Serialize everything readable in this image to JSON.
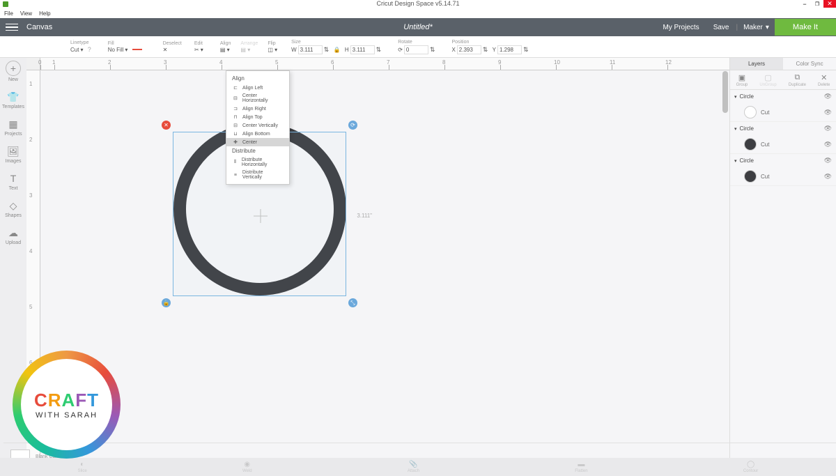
{
  "window": {
    "title": "Cricut Design Space  v5.14.71"
  },
  "menubar": {
    "file": "File",
    "view": "View",
    "help": "Help"
  },
  "topbar": {
    "canvas": "Canvas",
    "doctitle": "Untitled*",
    "myprojects": "My Projects",
    "save": "Save",
    "machine": "Maker",
    "makeit": "Make It"
  },
  "props": {
    "linetype_lbl": "Linetype",
    "linetype_val": "Cut",
    "fill_lbl": "Fill",
    "fill_val": "No Fill",
    "deselect_lbl": "Deselect",
    "edit_lbl": "Edit",
    "align_lbl": "Align",
    "arrange_lbl": "Arrange",
    "flip_lbl": "Flip",
    "size_lbl": "Size",
    "size_w": "3.111",
    "size_h": "3.111",
    "rotate_lbl": "Rotate",
    "rotate_val": "0",
    "position_lbl": "Position",
    "pos_x": "2.393",
    "pos_y": "1.298"
  },
  "leftnav": {
    "new": "New",
    "templates": "Templates",
    "projects": "Projects",
    "images": "Images",
    "text": "Text",
    "shapes": "Shapes",
    "upload": "Upload"
  },
  "alignmenu": {
    "align_hdr": "Align",
    "align_left": "Align Left",
    "center_h": "Center Horizontally",
    "align_right": "Align Right",
    "align_top": "Align Top",
    "center_v": "Center Vertically",
    "align_bottom": "Align Bottom",
    "center": "Center",
    "distribute_hdr": "Distribute",
    "dist_h": "Distribute Horizontally",
    "dist_v": "Distribute Vertically"
  },
  "selection": {
    "dim": "3.111\""
  },
  "rightpanel": {
    "layers_tab": "Layers",
    "colorsync_tab": "Color Sync",
    "group": "Group",
    "ungroup": "UnGroup",
    "duplicate": "Duplicate",
    "delete": "Delete",
    "layers": [
      {
        "name": "Circle",
        "op": "Cut",
        "color": "#ffffff"
      },
      {
        "name": "Circle",
        "op": "Cut",
        "color": "#3d3e42"
      },
      {
        "name": "Circle",
        "op": "Cut",
        "color": "#3d3e42"
      }
    ],
    "blankcanvas": "Blank Canvas",
    "slice": "Slice",
    "weld": "Weld",
    "attach": "Attach",
    "flatten": "Flatten",
    "contour": "Contour"
  },
  "ruler": {
    "h0": "0",
    "h1": "1",
    "h2": "2",
    "h3": "3",
    "h4": "4",
    "h5": "5",
    "h6": "6",
    "h7": "7",
    "h8": "8",
    "h9": "9",
    "h10": "10",
    "h11": "11",
    "h12": "12"
  },
  "watermark": {
    "craft": [
      "C",
      "R",
      "A",
      "F",
      "T"
    ],
    "sub": "WITH SARAH"
  }
}
